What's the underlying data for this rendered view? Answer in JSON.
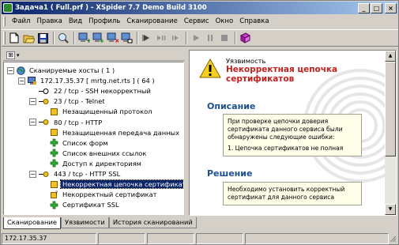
{
  "window": {
    "title": "Задача1 ( Full.prf ) - XSpider 7.7 Demo Build 3100",
    "buttons": {
      "minimize": "_",
      "maximize": "□",
      "close": "×"
    }
  },
  "menu": [
    "Файл",
    "Правка",
    "Вид",
    "Профиль",
    "Сканирование",
    "Сервис",
    "Окно",
    "Справка"
  ],
  "toolbar": {
    "icons": [
      "new-icon",
      "open-icon",
      "save-icon",
      "scan-icon",
      "add-host-icon",
      "add-hosts-icon",
      "remove-host-icon",
      "host-props-icon",
      "start-icon",
      "step-icon",
      "skip-icon",
      "play-icon",
      "pause-icon",
      "stop-icon",
      "report-icon"
    ]
  },
  "panel_strip": {
    "expand": "⊞"
  },
  "tree": [
    {
      "label": "Сканируемые хосты ( 1 )",
      "depth": 0,
      "icon": "globe-icon",
      "expander": "−"
    },
    {
      "label": "172.17.35.37 [ mrtg.net.rts ] ( 64 )",
      "depth": 1,
      "icon": "host-icon",
      "expander": "−"
    },
    {
      "label": "22 / tcp - SSH некорректный",
      "depth": 2,
      "icon": "port-key-icon"
    },
    {
      "label": "23 / tcp - Telnet",
      "depth": 2,
      "icon": "port-warn-icon",
      "expander": "−"
    },
    {
      "label": "Незащищенный протокол",
      "depth": 3,
      "icon": "square-warn-icon"
    },
    {
      "label": "80 / tcp - HTTP",
      "depth": 2,
      "icon": "port-warn-icon",
      "expander": "−"
    },
    {
      "label": "Незащищенная передача данных",
      "depth": 3,
      "icon": "square-warn-icon"
    },
    {
      "label": "Список форм",
      "depth": 3,
      "icon": "info-plus-icon"
    },
    {
      "label": "Список внешних ссылок",
      "depth": 3,
      "icon": "info-plus-icon"
    },
    {
      "label": "Доступ к директориям",
      "depth": 3,
      "icon": "info-plus-icon"
    },
    {
      "label": "443 / tcp - HTTP SSL",
      "depth": 2,
      "icon": "port-warn-icon",
      "expander": "−"
    },
    {
      "label": "Некорректная цепочка сертификатов",
      "depth": 3,
      "icon": "square-warn-icon",
      "selected": true
    },
    {
      "label": "Некорректный сертификат",
      "depth": 3,
      "icon": "square-question-icon"
    },
    {
      "label": "Сертификат SSL",
      "depth": 3,
      "icon": "info-plus-icon"
    }
  ],
  "detail": {
    "type_label": "Уязвимость",
    "title": "Некорректная цепочка сертификатов",
    "description_heading": "Описание",
    "description_text": "При проверке цепочки доверия сертификата данного сервиса были обнаружены следующие ошибки:",
    "description_item": "1. Цепочка сертификатов не полная",
    "solution_heading": "Решение",
    "solution_text": "Необходимо установить корректный сертификат для данного сервиса"
  },
  "tabs": [
    {
      "label": "Сканирование",
      "active": true
    },
    {
      "label": "Уязвимости",
      "active": false
    },
    {
      "label": "История сканирований",
      "active": false
    }
  ],
  "status": {
    "host": "172.17.35.37"
  },
  "colors": {
    "titlebar": "#0a246a",
    "title_red": "#c02020",
    "heading_blue": "#1a5090",
    "selection": "#0a246a"
  }
}
